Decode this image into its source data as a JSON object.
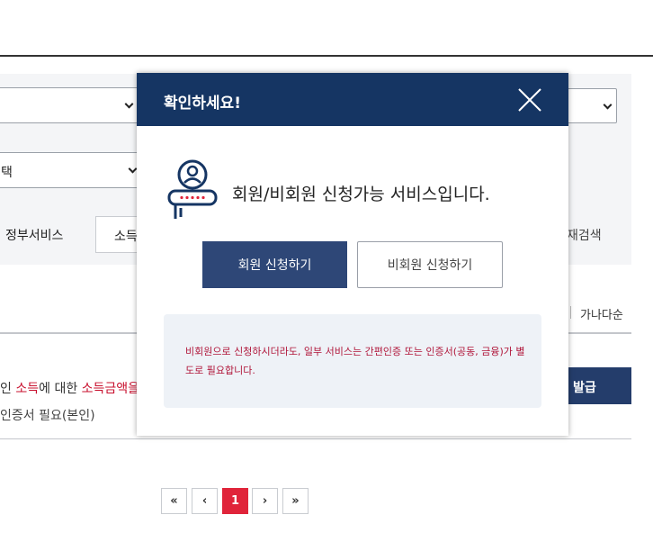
{
  "background": {
    "filter": {
      "select2_value": "택",
      "gov_service_label": "정부서비스",
      "tab_active_label": "소득",
      "research_label": "재검색"
    },
    "sort": {
      "label": "가나다순"
    },
    "result_row": {
      "desc_prefix": "인 ",
      "desc_red1": "소득",
      "desc_mid": "에 대한 ",
      "desc_red2": "소득금액을",
      "requirement": "인증서 필요(본인)",
      "issue_button": "발급"
    },
    "pagination": {
      "first": "«",
      "prev": "‹",
      "current": "1",
      "next": "›",
      "last": "»"
    }
  },
  "modal": {
    "title": "확인하세요!",
    "close_icon": "close-icon",
    "member_icon": "member-id-card-icon",
    "notice": "회원/비회원 신청가능 서비스입니다.",
    "member_button": "회원 신청하기",
    "guest_button": "비회원 신청하기",
    "info": "비회원으로 신청하시더라도, 일부 서비스는 간편인증 또는 인증서(공동, 금융)가 별도로 필요합니다."
  },
  "colors": {
    "modal_header": "#153563",
    "member_button": "#2e4777",
    "info_text": "#b0163a",
    "info_bg": "#eef2f7",
    "pager_active": "#e0243a",
    "accent_red": "#c8102e"
  }
}
